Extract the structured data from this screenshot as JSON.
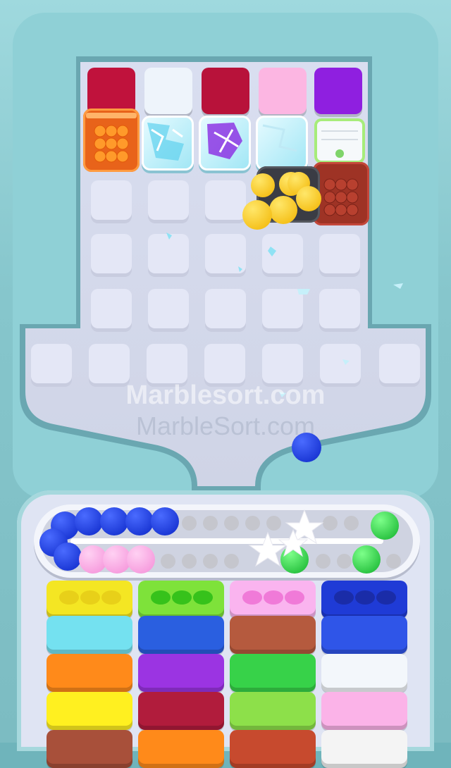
{
  "watermarks": {
    "primary": "Marblesort.com",
    "secondary": "MarbleSort.com"
  },
  "palette": {
    "frame": "#8fd0d6",
    "board": "#d7dcee",
    "tile": "#e4e7f6",
    "track": "#2f3137",
    "star": "#ffffff"
  },
  "top_row_colors": [
    "#c0123c",
    "#eef4fb",
    "#b8123a",
    "#fcb6e2",
    "#8f1fe0"
  ],
  "second_row": [
    {
      "kind": "crate",
      "color": "#f06a14",
      "icon": "orange-marble-crate-icon"
    },
    {
      "kind": "ice",
      "color": "#62d4f0",
      "icon": "ice-block-icon"
    },
    {
      "kind": "ice",
      "color": "#8a2be2",
      "icon": "ice-block-purple-icon"
    },
    {
      "kind": "ice",
      "color": "#e8f4fb",
      "icon": "ice-block-white-icon"
    },
    {
      "kind": "crate-empty",
      "color": "#a7ec7a",
      "icon": "green-crate-icon"
    }
  ],
  "bottom_boxes": [
    [
      "#f4e623",
      "#74e1f0",
      "#ff8a1a",
      "#fff020",
      "#a8503a"
    ],
    [
      "#7ee23a",
      "#2a5fe0",
      "#9b34e2",
      "#b11c3c",
      "#ff8a1a"
    ],
    [
      "#fab4ef",
      "#b55a3e",
      "#37d249",
      "#8de04a",
      "#c74a2e"
    ],
    [
      "#1f3bd6",
      "#2f55e8",
      "#f3f7fb",
      "#fbb3e8",
      "#f4f4f4"
    ]
  ],
  "top_slot_colors": [
    "#e8d019",
    "#36c21b",
    "#f07ad8",
    "#1a2ca8"
  ]
}
